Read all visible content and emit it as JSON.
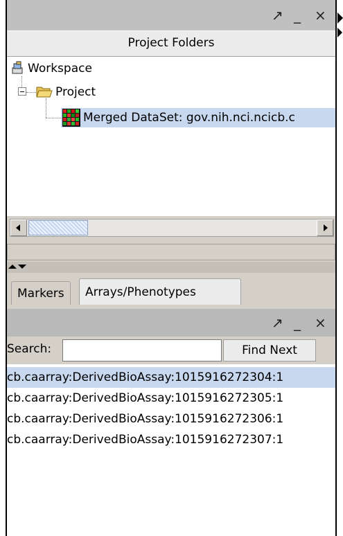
{
  "top_panel": {
    "controls": {
      "maximize": "↗",
      "minimize": "_",
      "close": "×"
    },
    "header": "Project Folders",
    "tree": {
      "workspace": "Workspace",
      "project": "Project",
      "dataset": "Merged DataSet: gov.nih.nci.ncicb.c"
    }
  },
  "tabs": [
    {
      "label": "Markers"
    },
    {
      "label": "Arrays/Phenotypes"
    }
  ],
  "bottom_panel": {
    "controls": {
      "maximize": "↗",
      "minimize": "_",
      "close": "×"
    },
    "search_label": "Search:",
    "search_value": "",
    "find_next": "Find Next",
    "items": [
      {
        "text": "cb.caarray:DerivedBioAssay:1015916272304:1"
      },
      {
        "text": "cb.caarray:DerivedBioAssay:1015916272305:1"
      },
      {
        "text": "cb.caarray:DerivedBioAssay:1015916272306:1"
      },
      {
        "text": "cb.caarray:DerivedBioAssay:1015916272307:1"
      }
    ]
  },
  "colors": {
    "selection": "#c8d8ee",
    "titlebar": "#c0c0c0"
  }
}
